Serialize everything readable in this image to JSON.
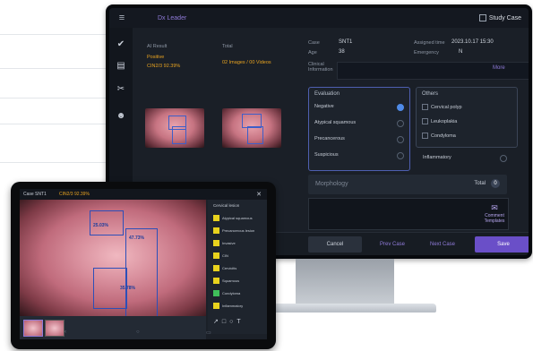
{
  "monitor": {
    "app_title": "Dx Leader",
    "right_title": "Study Case",
    "left": {
      "ai_result_label": "AI Result",
      "total_label": "Total",
      "ai_result_value": "Positive",
      "ai_result_detail": "CIN2/3 92.39%",
      "total_value": "02 Images / 00 Videos"
    },
    "fields": {
      "case_label": "Case",
      "case_value": "SNT1",
      "age_label": "Age",
      "age_value": "38",
      "clinical_label": "Clinical Information",
      "assigned_label": "Assigned time",
      "assigned_value": "2023.10.17 15:30",
      "emergency_label": "Emergency",
      "emergency_value": "N",
      "more": "More"
    },
    "evaluation": {
      "title": "Evaluation",
      "options": [
        "Negative",
        "Atypical squamous",
        "Precancerous",
        "Suspicious"
      ]
    },
    "others": {
      "title": "Others",
      "options": [
        "Cervical polyp",
        "Leukoplakia",
        "Condyloma"
      ],
      "inflammatory": "Inflammatory"
    },
    "morphology": {
      "label": "Morphology",
      "total": "Total",
      "count": "0"
    },
    "comment_btn": "Comment Templates",
    "buttons": {
      "cancel": "Cancel",
      "prev": "Prev Case",
      "next": "Next Case",
      "save": "Save"
    }
  },
  "tablet": {
    "status_left": "Case SNT1",
    "status_ai": "CIN2/3 92.39%",
    "labels": [
      "25.03%",
      "47.73%",
      "35.78%"
    ],
    "panel_title": "Cervical lesion",
    "panel_items": [
      "Atypical squamous",
      "Precancerous lesion",
      "Invasive",
      "CIN",
      "Cervicitis",
      "Squamous",
      "Condyloma",
      "Inflammatory"
    ]
  },
  "colors": {
    "accent": "#8f7ad8",
    "ai": "#e8a320",
    "save": "#6a4fc8",
    "box": "#2d4fb8"
  }
}
